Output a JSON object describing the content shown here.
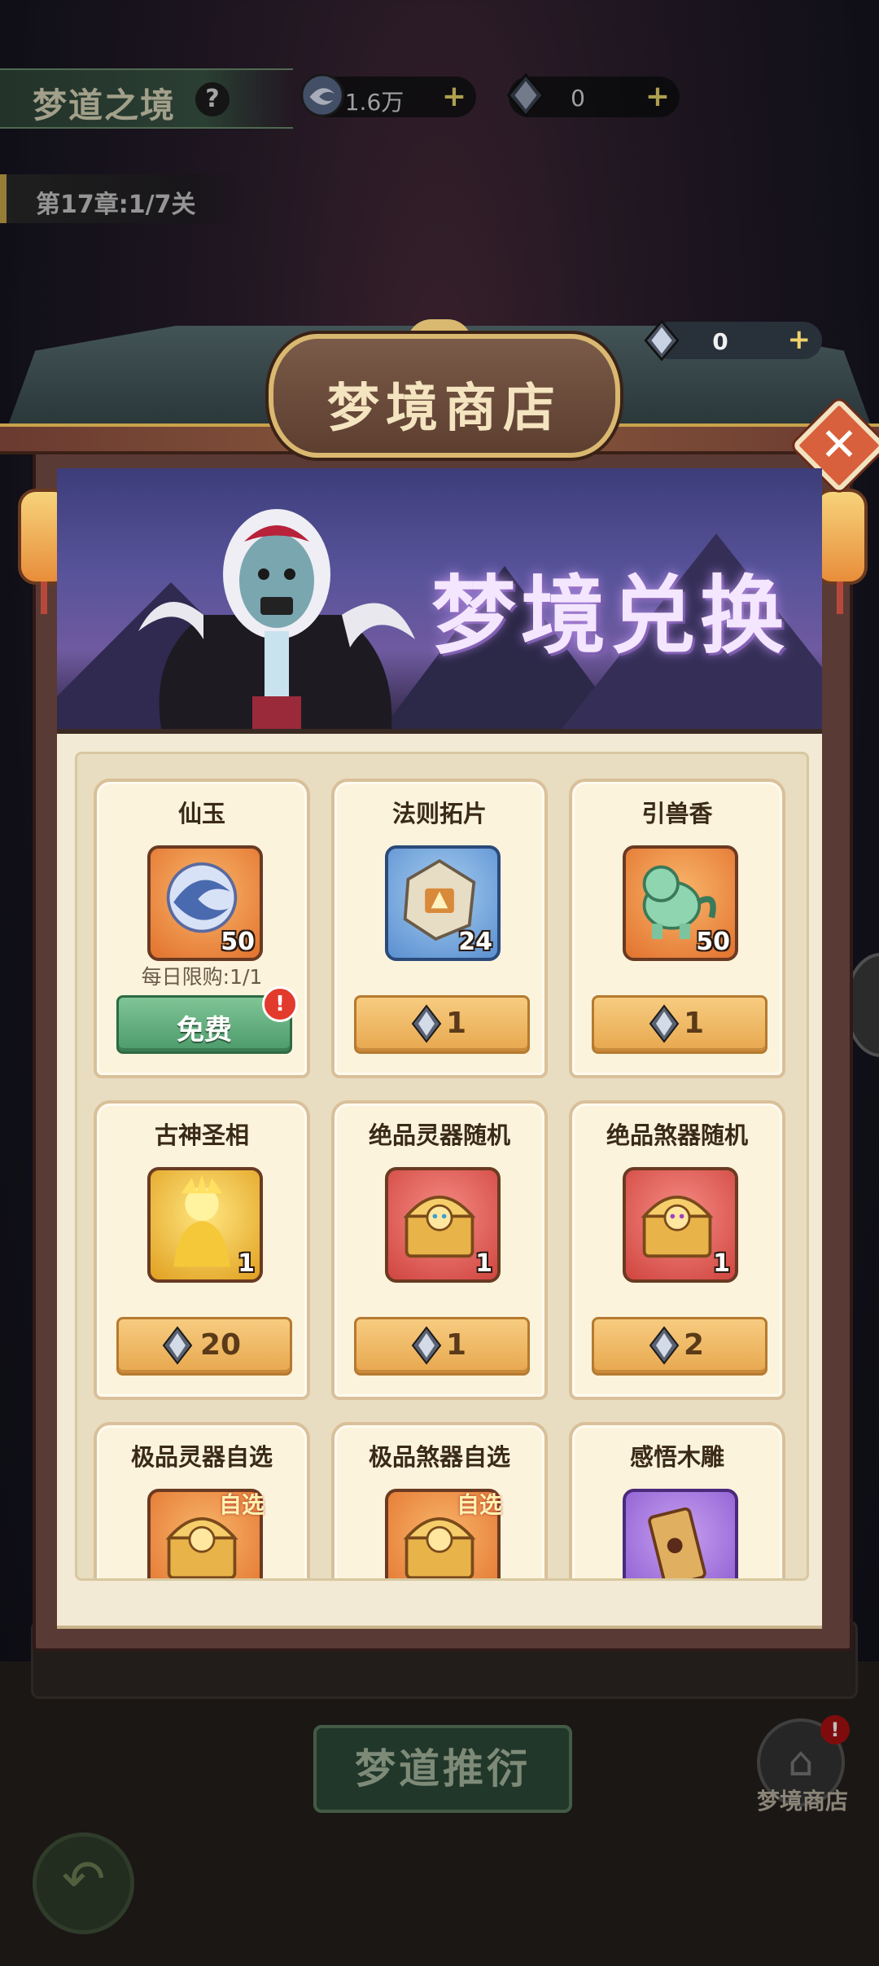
{
  "hud": {
    "title": "梦道之境",
    "help": "?",
    "currency1": {
      "value": "1.6万",
      "plus": "+"
    },
    "currency2": {
      "value": "0",
      "plus": "+"
    },
    "chapter": "第17章:1/7关"
  },
  "shop": {
    "title": "梦境商店",
    "currency": {
      "value": "0",
      "plus": "+"
    },
    "close": "✕",
    "banner_title": "梦境兑换",
    "items": [
      {
        "name": "仙玉",
        "qty": "50",
        "limit": "每日限购:1/1",
        "button": "免费",
        "badge": "!"
      },
      {
        "name": "法则拓片",
        "qty": "24",
        "price": "1"
      },
      {
        "name": "引兽香",
        "qty": "50",
        "price": "1"
      },
      {
        "name": "古神圣相",
        "qty": "1",
        "price": "20"
      },
      {
        "name": "绝品灵器随机",
        "qty": "1",
        "price": "1"
      },
      {
        "name": "绝品煞器随机",
        "qty": "1",
        "price": "2"
      },
      {
        "name": "极品灵器自选",
        "tag": "自选"
      },
      {
        "name": "极品煞器自选",
        "tag": "自选"
      },
      {
        "name": "感悟木雕"
      }
    ]
  },
  "bottom": {
    "push_button": "梦道推衍",
    "shop_label": "梦境商店",
    "shop_badge": "!",
    "back": "↶"
  },
  "icons": {
    "gem": "diamond-gem",
    "coin": "swirl-jade"
  }
}
